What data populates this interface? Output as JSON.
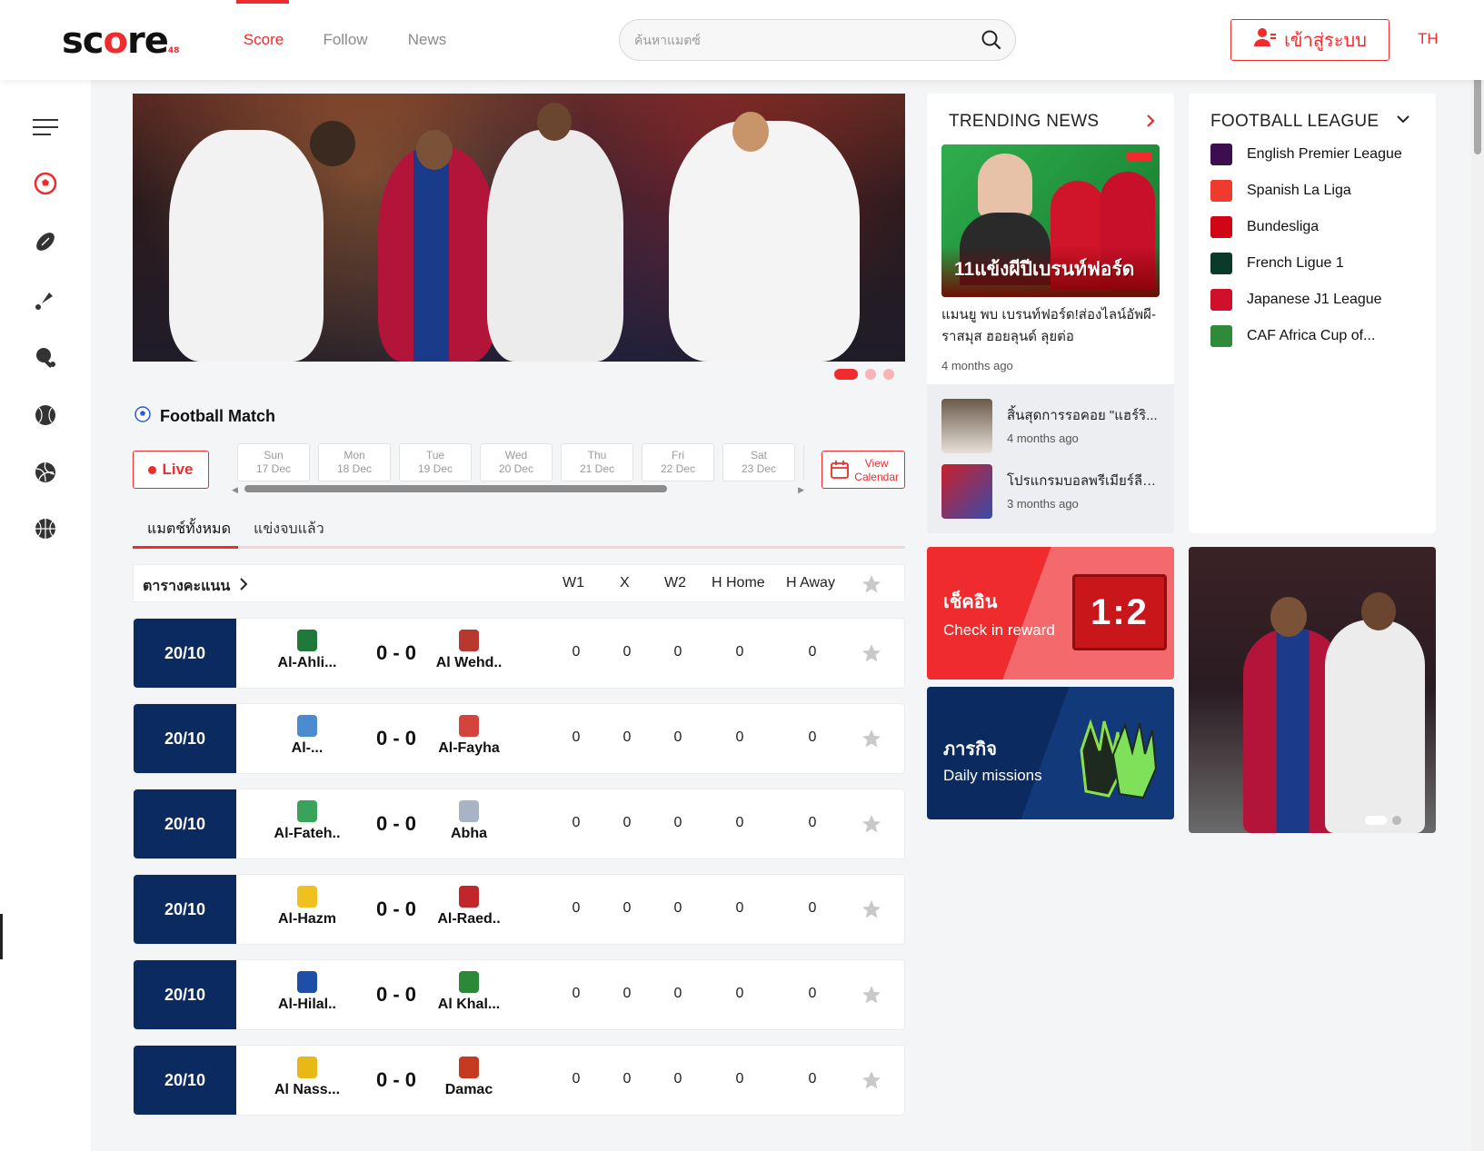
{
  "header": {
    "logo": {
      "main": "sc",
      "o": "o",
      "rest": "re",
      "suffix": "48"
    },
    "nav": [
      "Score",
      "Follow",
      "News"
    ],
    "active_nav": "Score",
    "search_placeholder": "ค้นหาแมตซ์",
    "login_label": "เข้าสู่ระบบ",
    "lang": "TH"
  },
  "sidebar": {
    "icons": [
      "menu-icon",
      "soccer-ball-icon",
      "american-football-icon",
      "badminton-icon",
      "table-tennis-icon",
      "baseball-icon",
      "volleyball-icon",
      "basketball-icon"
    ]
  },
  "match_section": {
    "title": "Football Match",
    "live_label": "Live",
    "days": [
      {
        "day": "Sun",
        "date": "17 Dec"
      },
      {
        "day": "Mon",
        "date": "18 Dec"
      },
      {
        "day": "Tue",
        "date": "19 Dec"
      },
      {
        "day": "Wed",
        "date": "20 Dec"
      },
      {
        "day": "Thu",
        "date": "21 Dec"
      },
      {
        "day": "Fri",
        "date": "22 Dec"
      },
      {
        "day": "Sat",
        "date": "23 Dec"
      }
    ],
    "calendar_label_1": "View",
    "calendar_label_2": "Calendar",
    "tabs": [
      "แมตช์ทั้งหมด",
      "แข่งจบแล้ว"
    ],
    "standings_label": "ตารางคะแนน",
    "columns": [
      "W1",
      "X",
      "W2",
      "H Home",
      "H Away"
    ],
    "matches": [
      {
        "date": "20/10",
        "home": "Al-Ahli...",
        "score": "0 - 0",
        "away": "Al Wehd..",
        "w1": "0",
        "x": "0",
        "w2": "0",
        "hh": "0",
        "ha": "0",
        "home_color": "#1f7a3a",
        "away_color": "#b8372e"
      },
      {
        "date": "20/10",
        "home": "Al-...",
        "score": "0 - 0",
        "away": "Al-Fayha",
        "w1": "0",
        "x": "0",
        "w2": "0",
        "hh": "0",
        "ha": "0",
        "home_color": "#4a8ccf",
        "away_color": "#d2443c"
      },
      {
        "date": "20/10",
        "home": "Al-Fateh..",
        "score": "0 - 0",
        "away": "Abha",
        "w1": "0",
        "x": "0",
        "w2": "0",
        "hh": "0",
        "ha": "0",
        "home_color": "#3aa35a",
        "away_color": "#a8b4c6"
      },
      {
        "date": "20/10",
        "home": "Al-Hazm",
        "score": "0 - 0",
        "away": "Al-Raed..",
        "w1": "0",
        "x": "0",
        "w2": "0",
        "hh": "0",
        "ha": "0",
        "home_color": "#f0c020",
        "away_color": "#c0262a"
      },
      {
        "date": "20/10",
        "home": "Al-Hilal..",
        "score": "0 - 0",
        "away": "Al Khal...",
        "w1": "0",
        "x": "0",
        "w2": "0",
        "hh": "0",
        "ha": "0",
        "home_color": "#1e4fa8",
        "away_color": "#2b8a3a"
      },
      {
        "date": "20/10",
        "home": "Al Nass...",
        "score": "0 - 0",
        "away": "Damac",
        "w1": "0",
        "x": "0",
        "w2": "0",
        "hh": "0",
        "ha": "0",
        "home_color": "#e8b814",
        "away_color": "#c63a22"
      }
    ]
  },
  "trending": {
    "title": "TRENDING NEWS",
    "featured_image_text": "11แข้งผีปีเบรนท์ฟอร์ด",
    "featured_headline": "แมนยู พบ เบรนท์ฟอร์ด!ส่องไลน์อัพผี-ราสมุส ฮอยลุนด์ ลุยต่อ",
    "featured_time": "4 months ago",
    "items": [
      {
        "title": "สิ้นสุดการรอคอย \"แฮร์ริ...",
        "time": "4 months ago"
      },
      {
        "title": "โปรแกรมบอลพรีเมียร์ลีก...",
        "time": "3 months ago"
      }
    ]
  },
  "leagues": {
    "title": "FOOTBALL LEAGUE",
    "items": [
      {
        "name": "English Premier League",
        "color": "#3d0d52"
      },
      {
        "name": "Spanish La Liga",
        "color": "#ef3b2d"
      },
      {
        "name": "Bundesliga",
        "color": "#d20515"
      },
      {
        "name": "French Ligue 1",
        "color": "#0a3a2a"
      },
      {
        "name": "Japanese J1 League",
        "color": "#d0102a"
      },
      {
        "name": "CAF Africa Cup of...",
        "color": "#2f8a3a"
      }
    ]
  },
  "promos": {
    "checkin_th": "เช็คอิน",
    "checkin_en": "Check in reward",
    "scoreboard": "1:2",
    "mission_th": "ภารกิจ",
    "mission_en": "Daily missions"
  }
}
